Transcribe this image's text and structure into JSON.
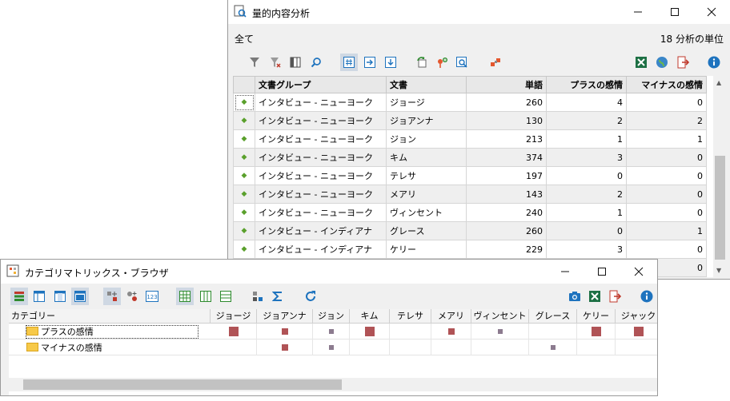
{
  "win1": {
    "title": "量的内容分析",
    "scope_label": "全て",
    "unit_label": "18 分析の単位",
    "controls": {
      "minimize": "—",
      "maximize": "☐",
      "close": "✕"
    },
    "columns": [
      "文書グループ",
      "文書",
      "単語",
      "プラスの感情",
      "マイナスの感情"
    ],
    "rows": [
      {
        "group": "インタビュー - ニューヨーク",
        "doc": "ジョージ",
        "words": "260",
        "pos": "4",
        "neg": "0"
      },
      {
        "group": "インタビュー - ニューヨーク",
        "doc": "ジョアンナ",
        "words": "130",
        "pos": "2",
        "neg": "2"
      },
      {
        "group": "インタビュー - ニューヨーク",
        "doc": "ジョン",
        "words": "213",
        "pos": "1",
        "neg": "1"
      },
      {
        "group": "インタビュー - ニューヨーク",
        "doc": "キム",
        "words": "374",
        "pos": "3",
        "neg": "0"
      },
      {
        "group": "インタビュー - ニューヨーク",
        "doc": "テレサ",
        "words": "197",
        "pos": "0",
        "neg": "0"
      },
      {
        "group": "インタビュー - ニューヨーク",
        "doc": "メアリ",
        "words": "143",
        "pos": "2",
        "neg": "0"
      },
      {
        "group": "インタビュー - ニューヨーク",
        "doc": "ヴィンセント",
        "words": "240",
        "pos": "1",
        "neg": "0"
      },
      {
        "group": "インタビュー - インディアナ",
        "doc": "グレース",
        "words": "260",
        "pos": "0",
        "neg": "1"
      },
      {
        "group": "インタビュー - インディアナ",
        "doc": "ケリー",
        "words": "229",
        "pos": "3",
        "neg": "0"
      },
      {
        "group": "",
        "doc": "",
        "words": "",
        "pos": "",
        "neg": "0"
      }
    ]
  },
  "win2": {
    "title": "カテゴリマトリックス・ブラウザ",
    "controls": {
      "minimize": "—",
      "maximize": "☐",
      "close": "✕"
    },
    "category_header": "カテゴリー",
    "documents": [
      "ジョージ",
      "ジョアンナ",
      "ジョン",
      "キム",
      "テレサ",
      "メアリ",
      "ヴィンセント",
      "グレース",
      "ケリー",
      "ジャック"
    ],
    "categories": [
      {
        "label": "プラスの感情",
        "values": [
          4,
          2,
          1,
          3,
          0,
          2,
          1,
          0,
          3,
          4
        ]
      },
      {
        "label": "マイナスの感情",
        "values": [
          0,
          2,
          1,
          0,
          0,
          0,
          0,
          1,
          0,
          0
        ]
      }
    ]
  },
  "colors": {
    "accent": "#1e73be",
    "marker": "#b05356",
    "excel": "#1d7044",
    "diamond": "#5aa02c"
  }
}
